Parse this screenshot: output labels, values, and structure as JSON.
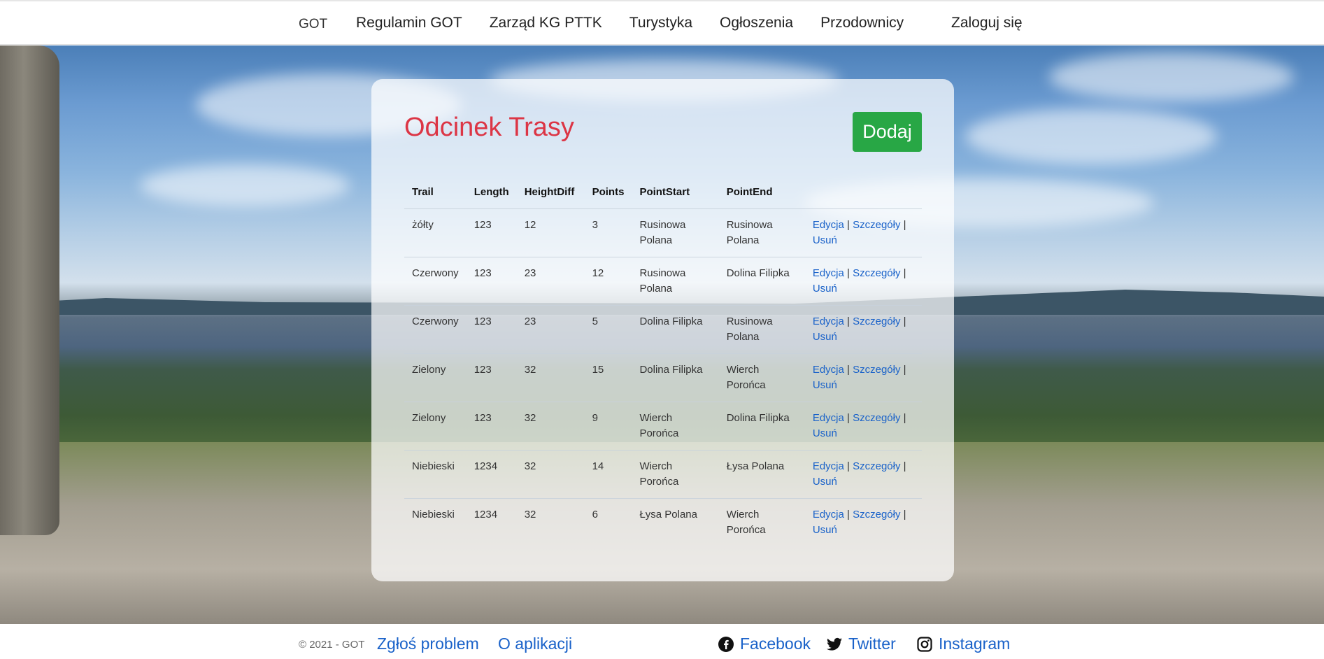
{
  "nav": {
    "brand": "GOT",
    "links": [
      "Regulamin GOT",
      "Zarząd KG PTTK",
      "Turystyka",
      "Ogłoszenia",
      "Przodownicy"
    ],
    "login": "Zaloguj się"
  },
  "card": {
    "title": "Odcinek Trasy",
    "add_label": "Dodaj"
  },
  "table": {
    "headers": [
      "Trail",
      "Length",
      "HeightDiff",
      "Points",
      "PointStart",
      "PointEnd"
    ],
    "action_labels": {
      "edit": "Edycja",
      "details": "Szczegóły",
      "delete": "Usuń",
      "separator": "|"
    },
    "rows": [
      [
        "żółty",
        "123",
        "12",
        "3",
        "Rusinowa Polana",
        "Rusinowa Polana"
      ],
      [
        "Czerwony",
        "123",
        "23",
        "12",
        "Rusinowa Polana",
        "Dolina Filipka"
      ],
      [
        "Czerwony",
        "123",
        "23",
        "5",
        "Dolina Filipka",
        "Rusinowa Polana"
      ],
      [
        "Zielony",
        "123",
        "32",
        "15",
        "Dolina Filipka",
        "Wierch Porońca"
      ],
      [
        "Zielony",
        "123",
        "32",
        "9",
        "Wierch Porońca",
        "Dolina Filipka"
      ],
      [
        "Niebieski",
        "1234",
        "32",
        "14",
        "Wierch Porońca",
        "Łysa Polana"
      ],
      [
        "Niebieski",
        "1234",
        "32",
        "6",
        "Łysa Polana",
        "Wierch Porońca"
      ]
    ]
  },
  "footer": {
    "copyright": "© 2021 - GOT",
    "report": "Zgłoś problem",
    "about": "O aplikacji",
    "facebook": "Facebook",
    "twitter": "Twitter",
    "instagram": "Instagram"
  },
  "colors": {
    "title": "#dc3545",
    "add_button": "#28a745",
    "link": "#1a62c9"
  },
  "icons": [
    "facebook-icon",
    "twitter-icon",
    "instagram-icon"
  ]
}
